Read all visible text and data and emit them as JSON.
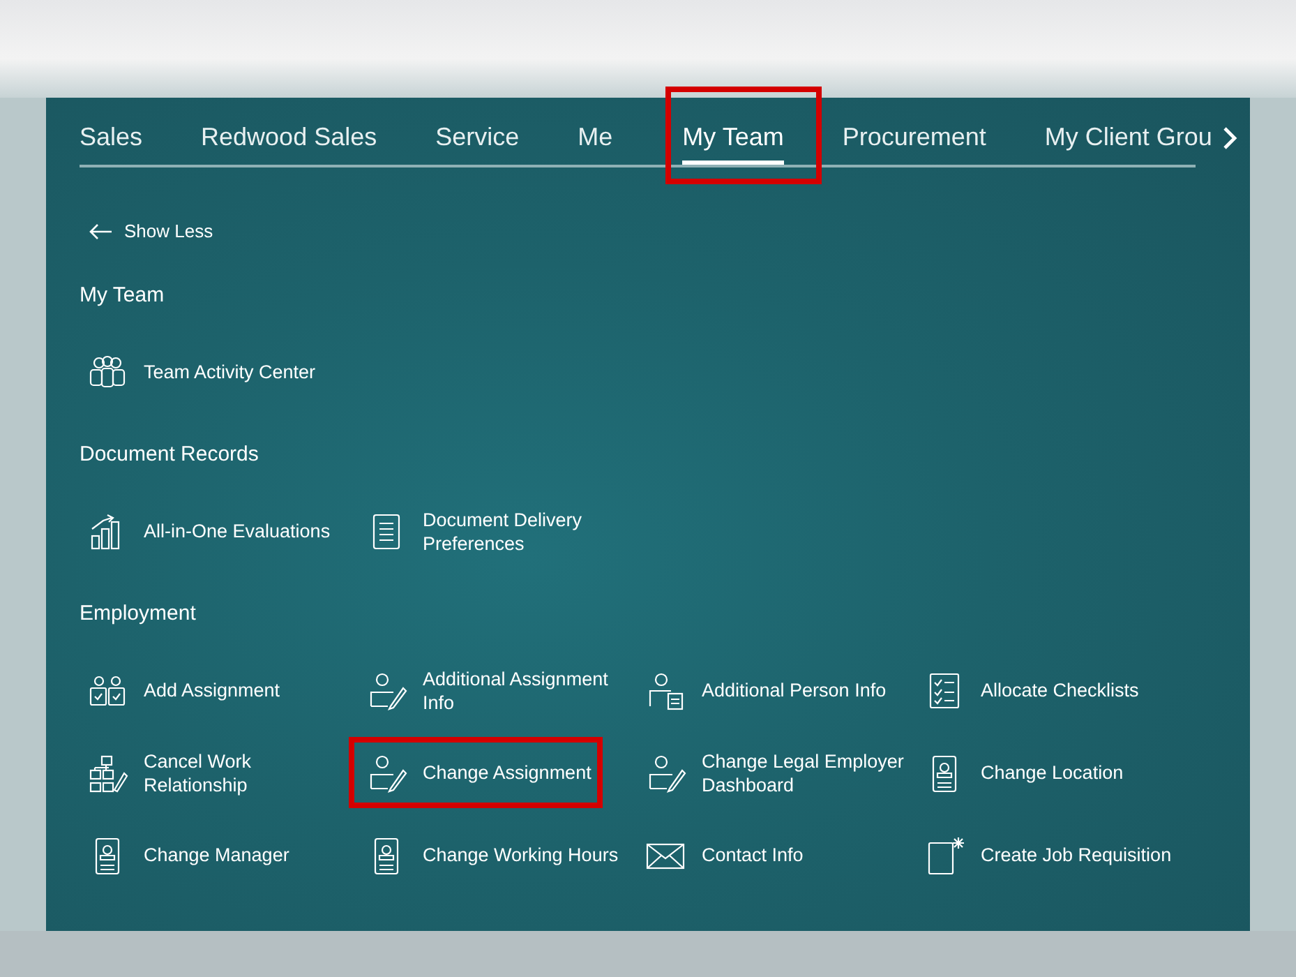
{
  "tabs": [
    {
      "label": "Sales",
      "selected": false,
      "highlighted": false
    },
    {
      "label": "Redwood Sales",
      "selected": false,
      "highlighted": false
    },
    {
      "label": "Service",
      "selected": false,
      "highlighted": false
    },
    {
      "label": "Me",
      "selected": false,
      "highlighted": false
    },
    {
      "label": "My Team",
      "selected": true,
      "highlighted": true
    },
    {
      "label": "Procurement",
      "selected": false,
      "highlighted": false
    },
    {
      "label": "My Client Grou",
      "selected": false,
      "highlighted": false
    }
  ],
  "show_less": "Show Less",
  "sections": [
    {
      "title": "My Team",
      "items": [
        {
          "label": "Team Activity Center",
          "highlighted": false
        }
      ]
    },
    {
      "title": "Document Records",
      "items": [
        {
          "label": "All-in-One Evaluations",
          "highlighted": false
        },
        {
          "label": "Document Delivery Preferences",
          "highlighted": false
        }
      ]
    },
    {
      "title": "Employment",
      "items": [
        {
          "label": "Add Assignment",
          "highlighted": false
        },
        {
          "label": "Additional Assignment Info",
          "highlighted": false
        },
        {
          "label": "Additional Person Info",
          "highlighted": false
        },
        {
          "label": "Allocate Checklists",
          "highlighted": false
        },
        {
          "label": "Cancel Work Relationship",
          "highlighted": false
        },
        {
          "label": "Change Assignment",
          "highlighted": true
        },
        {
          "label": "Change Legal Employer Dashboard",
          "highlighted": false
        },
        {
          "label": "Change Location",
          "highlighted": false
        },
        {
          "label": "Change Manager",
          "highlighted": false
        },
        {
          "label": "Change Working Hours",
          "highlighted": false
        },
        {
          "label": "Contact Info",
          "highlighted": false
        },
        {
          "label": "Create Job Requisition",
          "highlighted": false
        }
      ]
    }
  ]
}
